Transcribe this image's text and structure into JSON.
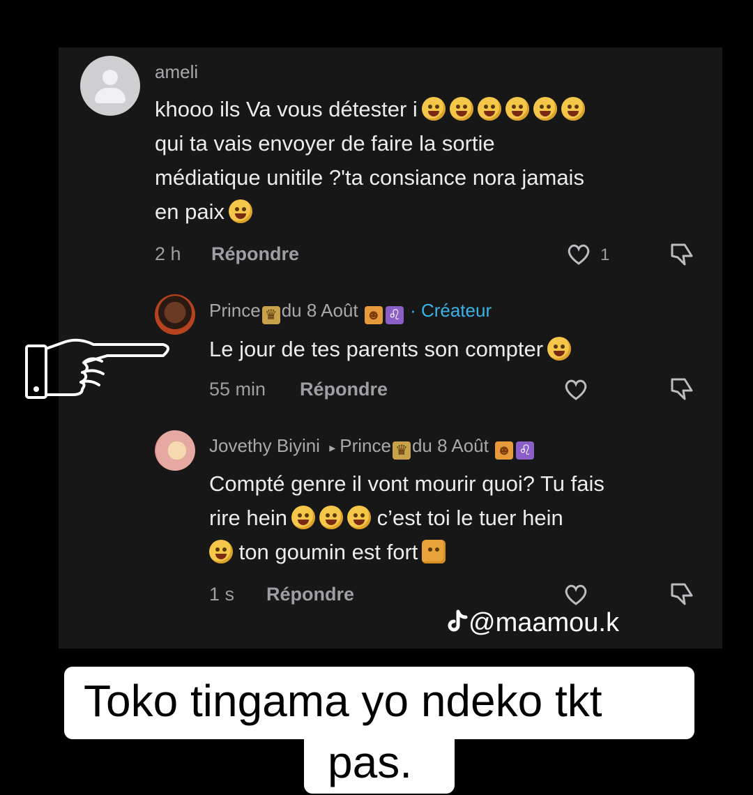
{
  "comments": [
    {
      "username": "ameli",
      "lines": [
        "khooo ils Va vous détester i",
        "qui ta vais envoyer de faire la sortie",
        "médiatique unitile ?'ta consiance nora jamais",
        "en paix"
      ],
      "time": "2 h",
      "reply_label": "Répondre",
      "like_count": "1"
    },
    {
      "username": "Prince",
      "username_suffix": "du 8 Août",
      "creator_label": "· Créateur",
      "lines": [
        "Le jour de tes parents son compter"
      ],
      "time": "55 min",
      "reply_label": "Répondre"
    },
    {
      "username": "Jovethy Biyini",
      "reply_to_prefix": "▸",
      "reply_to": "Prince",
      "reply_to_suffix": "du 8 Août",
      "lines": [
        "Compté genre il vont mourir quoi? Tu fais",
        "rire hein",
        "c’est toi le tuer hein",
        "ton goumin est fort"
      ],
      "time": "1 s",
      "reply_label": "Répondre"
    }
  ],
  "watermark": "@maamou.k",
  "caption": {
    "line1": "Toko tingama yo ndeko tkt",
    "line2": "pas."
  },
  "icons": [
    "heart-icon",
    "dislike-icon",
    "tiktok-icon",
    "pointing-hand-icon"
  ]
}
